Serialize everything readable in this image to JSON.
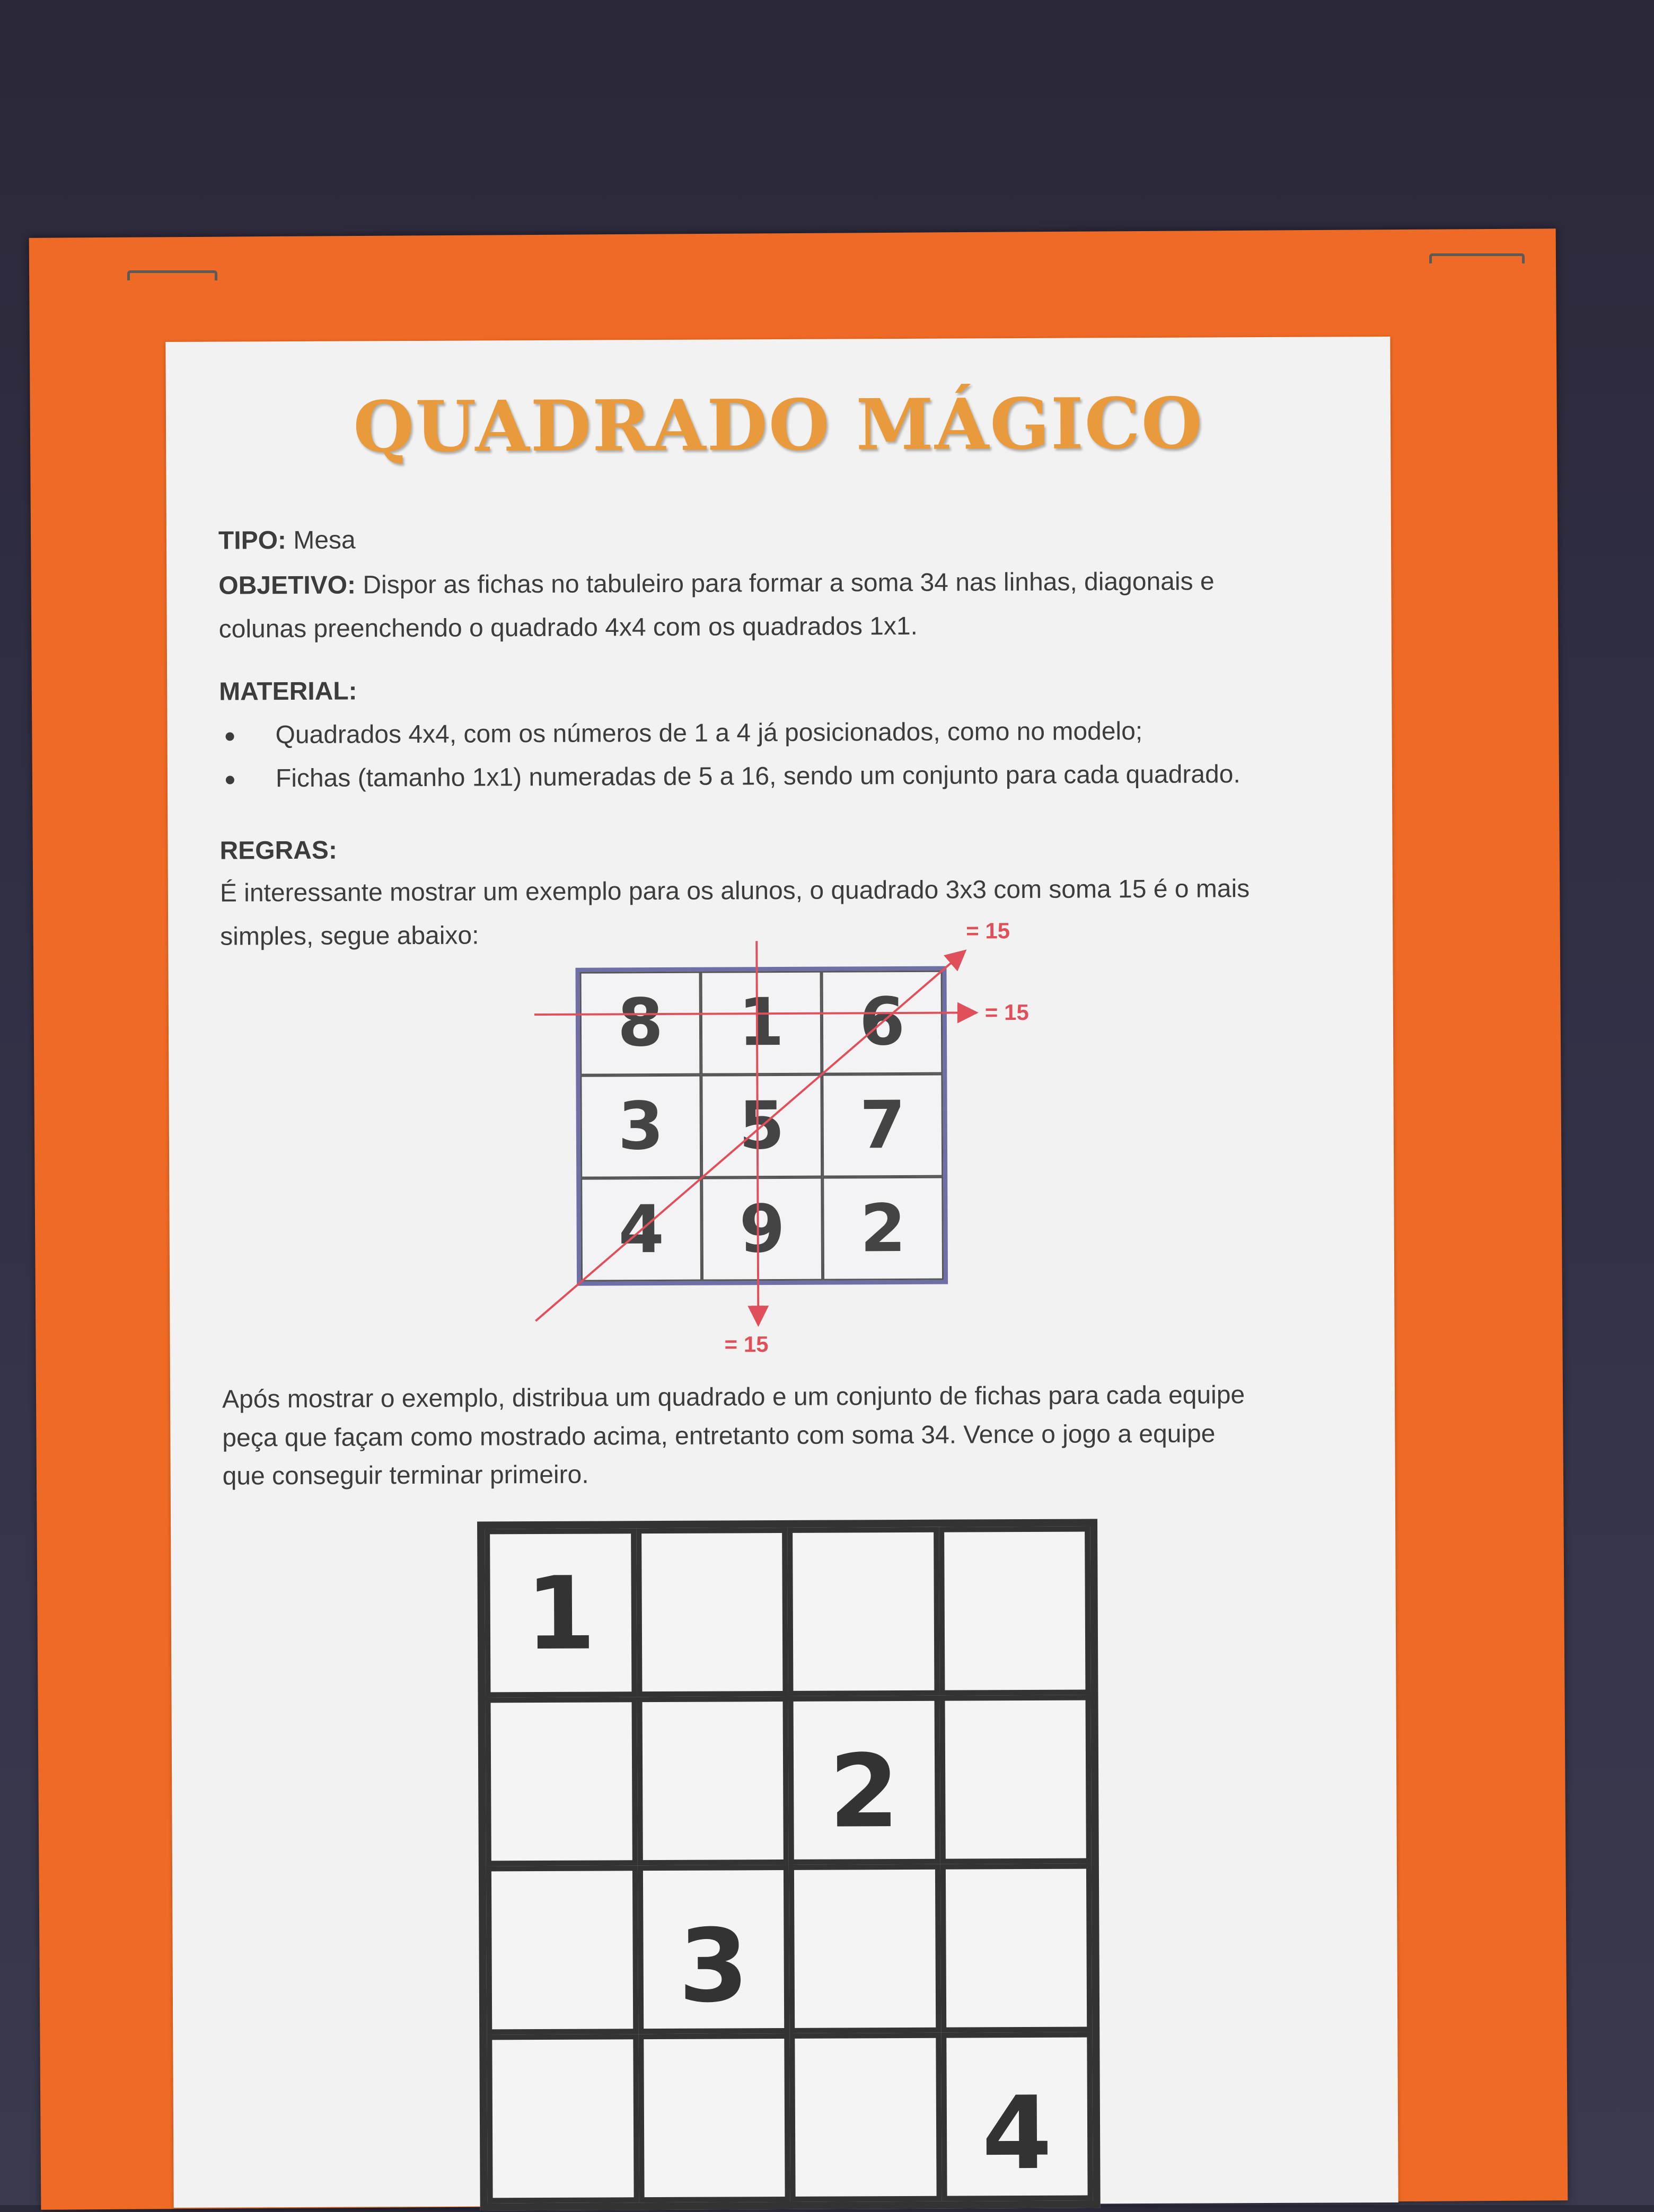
{
  "title": "QUADRADO MÁGICO",
  "tipo": {
    "label": "TIPO:",
    "value": "Mesa"
  },
  "objetivo": {
    "label": "OBJETIVO:",
    "line1": "Dispor as fichas no tabuleiro para formar a soma 34 nas linhas, diagonais e",
    "line2": "colunas preenchendo o quadrado 4x4 com os quadrados 1x1."
  },
  "material": {
    "label": "MATERIAL:",
    "items": [
      "Quadrados 4x4, com os números de 1 a 4 já posicionados, como no modelo;",
      "Fichas (tamanho 1x1) numeradas de 5 a 16, sendo um conjunto para cada quadrado."
    ]
  },
  "regras": {
    "label": "REGRAS:",
    "line1": "É interessante mostrar um exemplo para os alunos, o quadrado 3x3 com soma 15 é o mais",
    "line2": "simples, segue abaixo:"
  },
  "example_3x3": {
    "cells": [
      "8",
      "1",
      "6",
      "3",
      "5",
      "7",
      "4",
      "9",
      "2"
    ],
    "sum_labels": [
      "= 15",
      "= 15",
      "= 15"
    ],
    "line_color": "#e0505a",
    "border_color": "#6f6fa8"
  },
  "instructions": {
    "line1": "Após mostrar o exemplo, distribua um quadrado e um conjunto de fichas para cada equipe",
    "line2": "peça que façam como mostrado acima, entretanto com soma 34. Vence o jogo a equipe",
    "line3": "que conseguir terminar primeiro."
  },
  "board_4x4": {
    "cells": [
      "1",
      "",
      "",
      "",
      "",
      "",
      "2",
      "",
      "",
      "3",
      "",
      "",
      "",
      "",
      "",
      "4"
    ]
  },
  "colors": {
    "board_orange": "#ef6a24",
    "title_orange": "#e89a3c",
    "paper": "#f1f2f1"
  }
}
